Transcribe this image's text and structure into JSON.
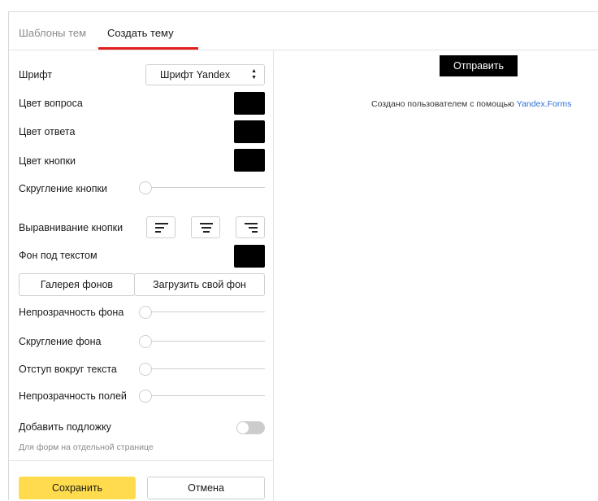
{
  "tabs": [
    {
      "label": "Шаблоны тем",
      "active": false
    },
    {
      "label": "Создать тему",
      "active": true
    }
  ],
  "accent_color": "#e31d1d",
  "settings": {
    "font": {
      "label": "Шрифт",
      "value": "Шрифт Yandex"
    },
    "question_color": {
      "label": "Цвет вопроса",
      "value": "#000000"
    },
    "answer_color": {
      "label": "Цвет ответа",
      "value": "#000000"
    },
    "button_color": {
      "label": "Цвет кнопки",
      "value": "#000000"
    },
    "button_rounding": {
      "label": "Скругление кнопки",
      "value": 0
    },
    "button_alignment": {
      "label": "Выравнивание кнопки",
      "options": [
        "left-align-icon",
        "center-align-icon",
        "right-align-icon"
      ]
    },
    "text_background": {
      "label": "Фон под текстом",
      "value": "#000000"
    },
    "background_gallery_button": "Галерея фонов",
    "upload_background_button": "Загрузить свой фон",
    "background_opacity": {
      "label": "Непрозрачность фона",
      "value": 0
    },
    "background_rounding": {
      "label": "Скругление фона",
      "value": 0
    },
    "text_padding": {
      "label": "Отступ вокруг текста",
      "value": 0
    },
    "fields_opacity": {
      "label": "Непрозрачность полей",
      "value": 0
    },
    "add_backdrop": {
      "label": "Добавить подложку",
      "enabled": false,
      "hint": "Для форм на отдельной странице"
    }
  },
  "footer": {
    "save_label": "Сохранить",
    "cancel_label": "Отмена",
    "save_color": "#ffdb4d"
  },
  "preview": {
    "submit_label": "Отправить",
    "credit_text": "Создано пользователем с помощью",
    "credit_link": "Yandex.Forms",
    "link_color": "#2e6fd6"
  }
}
